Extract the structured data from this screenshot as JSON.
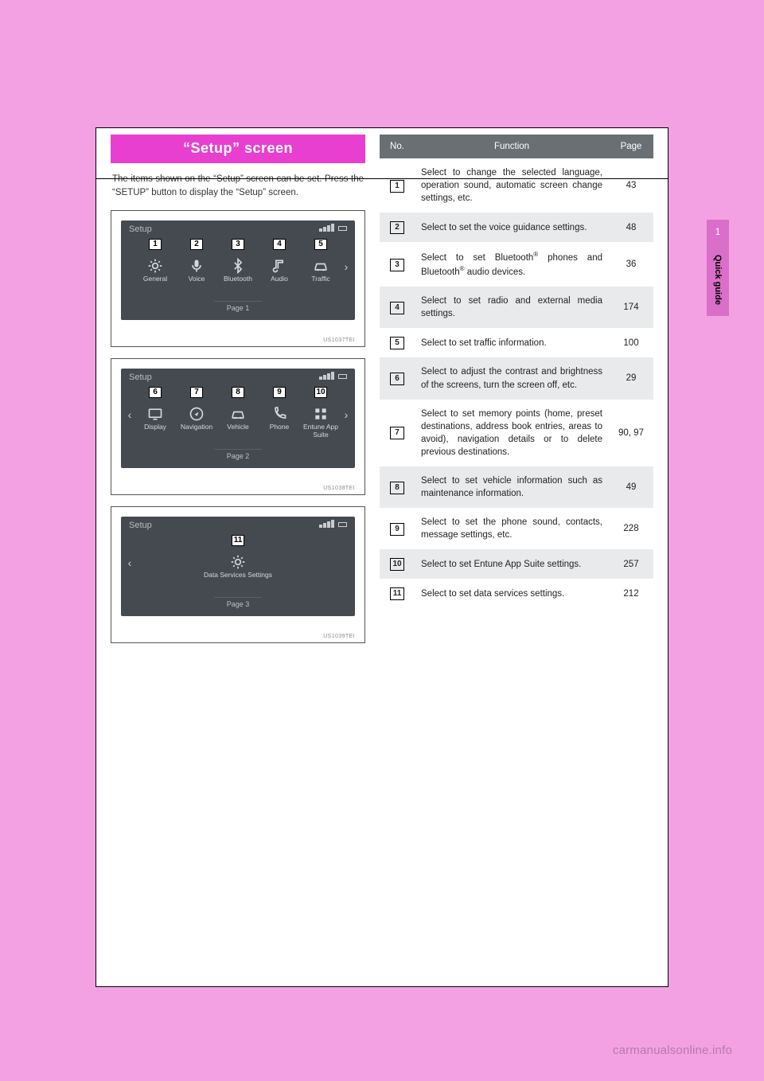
{
  "section_tab": {
    "number": "1",
    "label": "Quick guide"
  },
  "title_bar": "“Setup” screen",
  "intro": "The items shown on the “Setup” screen can be set. Press the “SETUP” button to display the “Setup” screen.",
  "screens": [
    {
      "header": "Setup",
      "pager": "Page 1",
      "caption": "US1037TEI",
      "chevron_left": false,
      "chevron_right": true,
      "items": [
        {
          "badge": "1",
          "label": "General",
          "icon": "gear-icon"
        },
        {
          "badge": "2",
          "label": "Voice",
          "icon": "mic-icon"
        },
        {
          "badge": "3",
          "label": "Bluetooth",
          "icon": "bluetooth-icon"
        },
        {
          "badge": "4",
          "label": "Audio",
          "icon": "note-icon"
        },
        {
          "badge": "5",
          "label": "Traffic",
          "icon": "car-icon"
        }
      ]
    },
    {
      "header": "Setup",
      "pager": "Page 2",
      "caption": "US1038TEI",
      "chevron_left": true,
      "chevron_right": true,
      "items": [
        {
          "badge": "6",
          "label": "Display",
          "icon": "display-icon"
        },
        {
          "badge": "7",
          "label": "Navigation",
          "icon": "compass-icon"
        },
        {
          "badge": "8",
          "label": "Vehicle",
          "icon": "car-icon"
        },
        {
          "badge": "9",
          "label": "Phone",
          "icon": "phone-icon"
        },
        {
          "badge": "10",
          "label": "Entune App Suite",
          "icon": "apps-icon"
        }
      ]
    },
    {
      "header": "Setup",
      "pager": "Page 3",
      "caption": "US1039TEI",
      "chevron_left": true,
      "chevron_right": false,
      "items": [
        {
          "badge": "11",
          "label": "Data Services Settings",
          "icon": "gear-icon"
        }
      ]
    }
  ],
  "table_headers": {
    "no": "No.",
    "function": "Function",
    "page": "Page"
  },
  "functions": [
    {
      "no": "1",
      "text": "Select to change the selected language, operation sound, automatic screen change settings, etc.",
      "page": "43"
    },
    {
      "no": "2",
      "text": "Select to set the voice guidance settings.",
      "page": "48"
    },
    {
      "no": "3",
      "html": "Select to set Bluetooth<sup>®</sup> phones and Bluetooth<sup>®</sup> audio devices.",
      "page": "36"
    },
    {
      "no": "4",
      "text": "Select to set radio and external media settings.",
      "page": "174"
    },
    {
      "no": "5",
      "text": "Select to set traffic information.",
      "page": "100"
    },
    {
      "no": "6",
      "text": "Select to adjust the contrast and brightness of the screens, turn the screen off, etc.",
      "page": "29"
    },
    {
      "no": "7",
      "text": "Select to set memory points (home, preset destinations, address book entries, areas to avoid), navigation details or to delete previous destinations.",
      "page": "90, 97"
    },
    {
      "no": "8",
      "text": "Select to set vehicle information such as maintenance information.",
      "page": "49"
    },
    {
      "no": "9",
      "text": "Select to set the phone sound, contacts, message settings, etc.",
      "page": "228"
    },
    {
      "no": "10",
      "text": "Select to set Entune App Suite settings.",
      "page": "257"
    },
    {
      "no": "11",
      "text": "Select to set data services settings.",
      "page": "212"
    }
  ],
  "watermark": "carmanualsonline.info"
}
